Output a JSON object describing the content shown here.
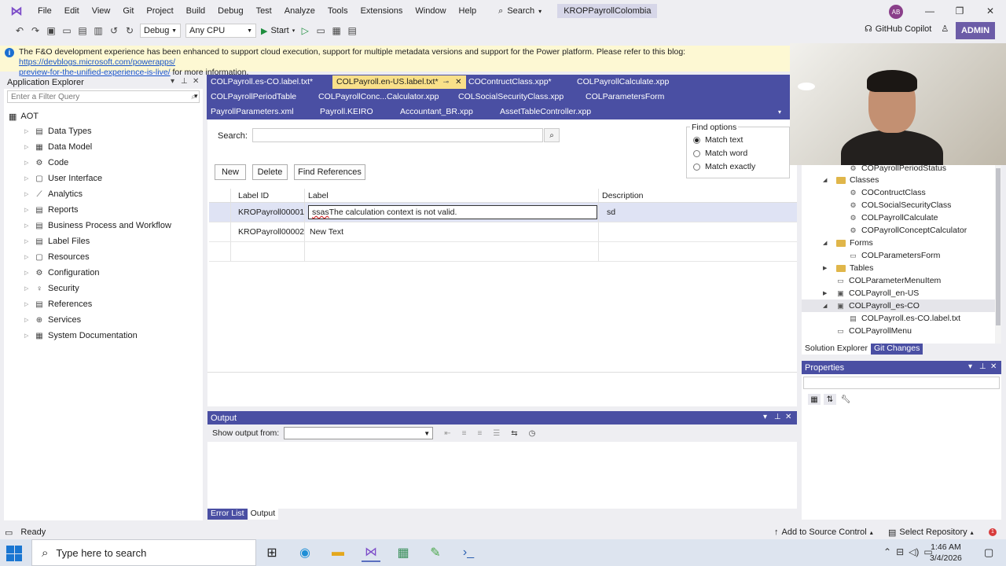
{
  "menu": {
    "items": [
      "File",
      "Edit",
      "View",
      "Git",
      "Project",
      "Build",
      "Debug",
      "Test",
      "Analyze",
      "Tools",
      "Extensions",
      "Window",
      "Help"
    ],
    "search_label": "Search",
    "solution_name": "KROPPayrollColombia",
    "avatar_initials": "AB"
  },
  "toolbar": {
    "config": "Debug",
    "platform": "Any CPU",
    "start_label": "Start",
    "copilot_label": "GitHub Copilot",
    "admin_label": "ADMIN"
  },
  "infobar": {
    "text": "The F&O development experience has been enhanced to support cloud execution, support for multiple metadata versions and support for the Power platform. Please refer to this blog:",
    "link": "https://devblogs.microsoft.com/powerapps/",
    "link_cont": "preview-for-the-unified-experience-is-live/",
    "tail": "for more information."
  },
  "app_explorer": {
    "title": "Application Explorer",
    "filter_placeholder": "Enter a Filter Query",
    "root": "AOT",
    "nodes": [
      "Data Types",
      "Data Model",
      "Code",
      "User Interface",
      "Analytics",
      "Reports",
      "Business Process and Workflow",
      "Label Files",
      "Resources",
      "Configuration",
      "Security",
      "References",
      "Services",
      "System Documentation"
    ]
  },
  "tabs": {
    "row1": [
      "COLPayroll.es-CO.label.txt*",
      "COLPayroll.en-US.label.txt*",
      "COContructClass.xpp*",
      "COLPayrollCalculate.xpp"
    ],
    "row2": [
      "COLPayrollPeriodTable",
      "COLPayrollConc...Calculator.xpp",
      "COLSocialSecurityClass.xpp",
      "COLParametersForm"
    ],
    "row3": [
      "PayrollParameters.xml",
      "Payroll.KEIRO",
      "Accountant_BR.xpp",
      "AssetTableController.xpp"
    ]
  },
  "editor": {
    "search_label": "Search:",
    "search_value": "",
    "buttons": {
      "new": "New",
      "delete": "Delete",
      "find_refs": "Find References"
    },
    "find_options": {
      "title": "Find options",
      "options": [
        "Match text",
        "Match word",
        "Match exactly"
      ],
      "selected": "Match text"
    },
    "columns": [
      "Label ID",
      "Label",
      "Description"
    ],
    "rows": [
      {
        "id": "KROPayroll00001",
        "label_err": "ssas",
        "label": "The calculation context is not valid.",
        "description": "sd"
      },
      {
        "id": "KROPayroll00002",
        "label": "New Text",
        "description": ""
      }
    ]
  },
  "output": {
    "title": "Output",
    "show_from_label": "Show output from:",
    "show_from_value": ""
  },
  "bottom_tabs": [
    "Error List",
    "Output"
  ],
  "solution_explorer": {
    "nodes": [
      {
        "label": "COPayrollPeriodStatus",
        "icon": "class-icon"
      },
      {
        "label": "Classes",
        "icon": "folder-icon"
      },
      {
        "label": "COContructClass",
        "icon": "class-icon"
      },
      {
        "label": "COLSocialSecurityClass",
        "icon": "class-icon"
      },
      {
        "label": "COLPayrollCalculate",
        "icon": "class-icon"
      },
      {
        "label": "COPayrollConceptCalculator",
        "icon": "class-icon"
      },
      {
        "label": "Forms",
        "icon": "folder-icon"
      },
      {
        "label": "COLParametersForm",
        "icon": "form-icon"
      },
      {
        "label": "Tables",
        "icon": "folder-icon"
      },
      {
        "label": "COLParameterMenuItem",
        "icon": "menuitem-icon"
      },
      {
        "label": "COLPayroll_en-US",
        "icon": "labelfile-icon"
      },
      {
        "label": "COLPayroll_es-CO",
        "icon": "labelfile-icon"
      },
      {
        "label": "COLPayroll.es-CO.label.txt",
        "icon": "file-icon"
      },
      {
        "label": "COLPayrollMenu",
        "icon": "menu-icon"
      }
    ],
    "tabs": [
      "Solution Explorer",
      "Git Changes"
    ]
  },
  "properties": {
    "title": "Properties"
  },
  "statusbar": {
    "ready": "Ready",
    "source_control": "Add to Source Control",
    "repository": "Select Repository",
    "notifications": "1"
  },
  "taskbar": {
    "search_placeholder": "Type here to search",
    "time": "1:46 AM",
    "date": "3/4/2026"
  },
  "colors": {
    "accent": "#4a4fa3",
    "active_tab": "#f9e089",
    "info_bg": "#fdf8d3",
    "admin": "#6c5ca7"
  }
}
